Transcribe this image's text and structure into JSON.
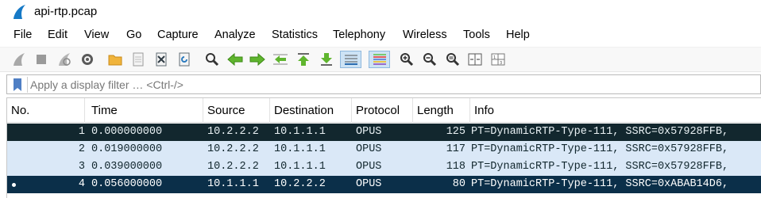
{
  "window": {
    "title": "api-rtp.pcap",
    "app_icon": "wireshark-fin-icon"
  },
  "menu": [
    "File",
    "Edit",
    "View",
    "Go",
    "Capture",
    "Analyze",
    "Statistics",
    "Telephony",
    "Wireless",
    "Tools",
    "Help"
  ],
  "toolbar": {
    "icons": [
      "start-capture-icon",
      "stop-capture-icon",
      "restart-capture-icon",
      "capture-options-icon",
      "open-file-icon",
      "save-file-icon",
      "close-file-icon",
      "reload-file-icon",
      "find-packet-icon",
      "go-back-icon",
      "go-forward-icon",
      "go-to-packet-icon",
      "go-first-packet-icon",
      "go-last-packet-icon",
      "auto-scroll-icon",
      "colorize-icon",
      "zoom-in-icon",
      "zoom-out-icon",
      "normal-size-icon",
      "resize-columns-icon"
    ],
    "selected": [
      "auto-scroll-icon",
      "colorize-icon"
    ]
  },
  "filter": {
    "placeholder": "Apply a display filter … <Ctrl-/>",
    "value": ""
  },
  "packet_list": {
    "columns": [
      "No.",
      "Time",
      "Source",
      "Destination",
      "Protocol",
      "Length",
      "Info"
    ],
    "rows": [
      {
        "no": "1",
        "time": "0.000000000",
        "source": "10.2.2.2",
        "destination": "10.1.1.1",
        "protocol": "OPUS",
        "length": "125",
        "info": "PT=DynamicRTP-Type-111, SSRC=0x57928FFB,",
        "style": "dark",
        "marker": ""
      },
      {
        "no": "2",
        "time": "0.019000000",
        "source": "10.2.2.2",
        "destination": "10.1.1.1",
        "protocol": "OPUS",
        "length": "117",
        "info": "PT=DynamicRTP-Type-111, SSRC=0x57928FFB,",
        "style": "light",
        "marker": ""
      },
      {
        "no": "3",
        "time": "0.039000000",
        "source": "10.2.2.2",
        "destination": "10.1.1.1",
        "protocol": "OPUS",
        "length": "118",
        "info": "PT=DynamicRTP-Type-111, SSRC=0x57928FFB,",
        "style": "light",
        "marker": ""
      },
      {
        "no": "4",
        "time": "0.056000000",
        "source": "10.1.1.1",
        "destination": "10.2.2.2",
        "protocol": "OPUS",
        "length": "80",
        "info": "PT=DynamicRTP-Type-111, SSRC=0xABAB14D6,",
        "style": "selected",
        "marker": "•"
      }
    ]
  }
}
